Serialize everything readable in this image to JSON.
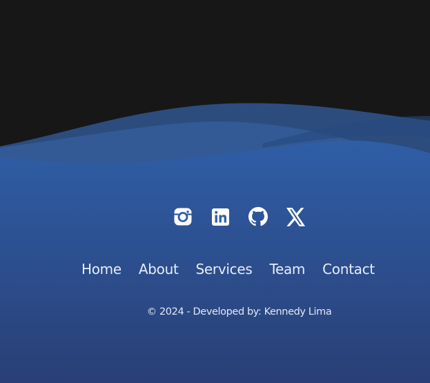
{
  "footer": {
    "social_links": [
      {
        "name": "instagram-icon",
        "label": "Instagram"
      },
      {
        "name": "linkedin-icon",
        "label": "LinkedIn"
      },
      {
        "name": "github-icon",
        "label": "GitHub"
      },
      {
        "name": "x-icon",
        "label": "X"
      }
    ],
    "nav": {
      "home": "Home",
      "about": "About",
      "services": "Services",
      "team": "Team",
      "contact": "Contact"
    },
    "copyright": "© 2024 - Developed by: Kennedy Lima"
  },
  "colors": {
    "background_dark": "#171717",
    "footer_blue_top": "#2f5ea6",
    "footer_blue_bottom": "#2a4a85",
    "wave_light": "#3a68ad",
    "text": "#e7edf8"
  }
}
